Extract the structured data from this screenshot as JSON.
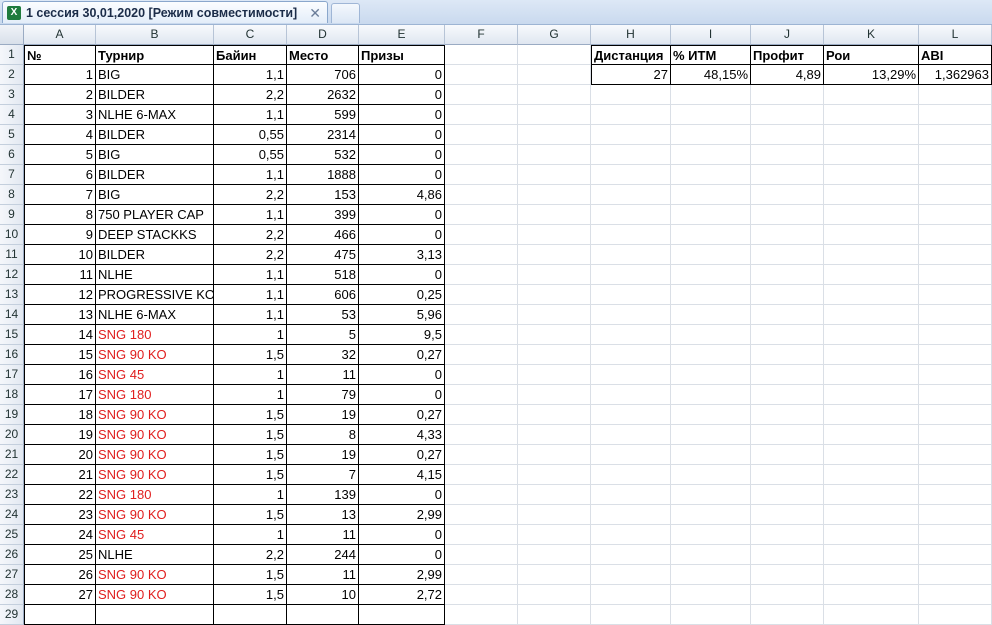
{
  "tab": {
    "title": "1 сессия 30,01,2020  [Режим совместимости]",
    "icon": "excel-icon",
    "close_glyph": "✕"
  },
  "columns": [
    "A",
    "B",
    "C",
    "D",
    "E",
    "F",
    "G",
    "H",
    "I",
    "J",
    "K",
    "L"
  ],
  "headers": {
    "A": "№",
    "B": "Турнир",
    "C": "Байин",
    "D": "Место",
    "E": "Призы"
  },
  "stats": {
    "labels": [
      "Дистанция",
      "% ИТМ",
      "Профит",
      "Рои",
      "ABI"
    ],
    "values": [
      "27",
      "48,15%",
      "4,89",
      "13,29%",
      "1,362963"
    ]
  },
  "rows": [
    {
      "n": "1",
      "name": "BIG",
      "buyin": "1,1",
      "place": "706",
      "prize": "0",
      "red": false
    },
    {
      "n": "2",
      "name": "BILDER",
      "buyin": "2,2",
      "place": "2632",
      "prize": "0",
      "red": false
    },
    {
      "n": "3",
      "name": "NLHE 6-MAX",
      "buyin": "1,1",
      "place": "599",
      "prize": "0",
      "red": false
    },
    {
      "n": "4",
      "name": "BILDER",
      "buyin": "0,55",
      "place": "2314",
      "prize": "0",
      "red": false
    },
    {
      "n": "5",
      "name": "BIG",
      "buyin": "0,55",
      "place": "532",
      "prize": "0",
      "red": false
    },
    {
      "n": "6",
      "name": "BILDER",
      "buyin": "1,1",
      "place": "1888",
      "prize": "0",
      "red": false
    },
    {
      "n": "7",
      "name": "BIG",
      "buyin": "2,2",
      "place": "153",
      "prize": "4,86",
      "red": false
    },
    {
      "n": "8",
      "name": "750 PLAYER CAP",
      "buyin": "1,1",
      "place": "399",
      "prize": "0",
      "red": false
    },
    {
      "n": "9",
      "name": "DEEP STACKKS",
      "buyin": "2,2",
      "place": "466",
      "prize": "0",
      "red": false
    },
    {
      "n": "10",
      "name": "BILDER",
      "buyin": "2,2",
      "place": "475",
      "prize": "3,13",
      "red": false
    },
    {
      "n": "11",
      "name": "NLHE",
      "buyin": "1,1",
      "place": "518",
      "prize": "0",
      "red": false
    },
    {
      "n": "12",
      "name": "PROGRESSIVE KO",
      "buyin": "1,1",
      "place": "606",
      "prize": "0,25",
      "red": false
    },
    {
      "n": "13",
      "name": "NLHE 6-MAX",
      "buyin": "1,1",
      "place": "53",
      "prize": "5,96",
      "red": false
    },
    {
      "n": "14",
      "name": "SNG 180",
      "buyin": "1",
      "place": "5",
      "prize": "9,5",
      "red": true
    },
    {
      "n": "15",
      "name": "SNG 90 KO",
      "buyin": "1,5",
      "place": "32",
      "prize": "0,27",
      "red": true
    },
    {
      "n": "16",
      "name": "SNG 45",
      "buyin": "1",
      "place": "11",
      "prize": "0",
      "red": true
    },
    {
      "n": "17",
      "name": "SNG 180",
      "buyin": "1",
      "place": "79",
      "prize": "0",
      "red": true
    },
    {
      "n": "18",
      "name": "SNG 90 KO",
      "buyin": "1,5",
      "place": "19",
      "prize": "0,27",
      "red": true
    },
    {
      "n": "19",
      "name": "SNG 90 KO",
      "buyin": "1,5",
      "place": "8",
      "prize": "4,33",
      "red": true
    },
    {
      "n": "20",
      "name": "SNG 90 KO",
      "buyin": "1,5",
      "place": "19",
      "prize": "0,27",
      "red": true
    },
    {
      "n": "21",
      "name": "SNG 90 KO",
      "buyin": "1,5",
      "place": "7",
      "prize": "4,15",
      "red": true
    },
    {
      "n": "22",
      "name": "SNG 180",
      "buyin": "1",
      "place": "139",
      "prize": "0",
      "red": true
    },
    {
      "n": "23",
      "name": "SNG 90 KO",
      "buyin": "1,5",
      "place": "13",
      "prize": "2,99",
      "red": true
    },
    {
      "n": "24",
      "name": "SNG 45",
      "buyin": "1",
      "place": "11",
      "prize": "0",
      "red": true
    },
    {
      "n": "25",
      "name": "NLHE",
      "buyin": "2,2",
      "place": "244",
      "prize": "0",
      "red": false
    },
    {
      "n": "26",
      "name": "SNG 90 KO",
      "buyin": "1,5",
      "place": "11",
      "prize": "2,99",
      "red": true
    },
    {
      "n": "27",
      "name": "SNG 90 KO",
      "buyin": "1,5",
      "place": "10",
      "prize": "2,72",
      "red": true
    }
  ],
  "colors": {
    "red_text": "#e01d1d",
    "header_bg": "#dfe6f0",
    "gridline": "#dadfe6"
  }
}
